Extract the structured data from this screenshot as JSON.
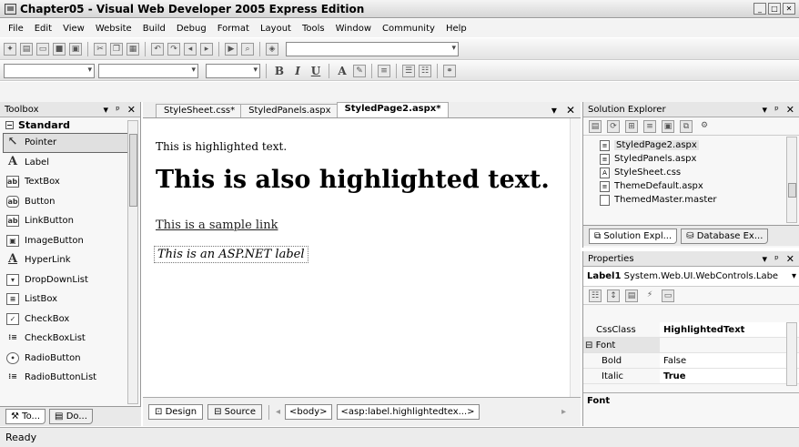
{
  "window": {
    "title": "Chapter05 - Visual Web Developer 2005 Express Edition"
  },
  "menu": [
    "File",
    "Edit",
    "View",
    "Website",
    "Build",
    "Debug",
    "Format",
    "Layout",
    "Tools",
    "Window",
    "Community",
    "Help"
  ],
  "toolbox": {
    "title": "Toolbox",
    "section": "Standard",
    "items": [
      {
        "label": "Pointer",
        "icon": "pointer-icon",
        "selected": true
      },
      {
        "label": "Label",
        "icon": "label-icon"
      },
      {
        "label": "TextBox",
        "icon": "textbox-icon"
      },
      {
        "label": "Button",
        "icon": "button-icon"
      },
      {
        "label": "LinkButton",
        "icon": "linkbutton-icon"
      },
      {
        "label": "ImageButton",
        "icon": "imagebutton-icon"
      },
      {
        "label": "HyperLink",
        "icon": "hyperlink-icon"
      },
      {
        "label": "DropDownList",
        "icon": "dropdownlist-icon"
      },
      {
        "label": "ListBox",
        "icon": "listbox-icon"
      },
      {
        "label": "CheckBox",
        "icon": "checkbox-icon"
      },
      {
        "label": "CheckBoxList",
        "icon": "checkboxlist-icon"
      },
      {
        "label": "RadioButton",
        "icon": "radiobutton-icon"
      },
      {
        "label": "RadioButtonList",
        "icon": "radiobuttonlist-icon"
      }
    ],
    "bottom_tabs": [
      "To...",
      "Do..."
    ]
  },
  "editor": {
    "tabs": [
      {
        "label": "StyleSheet.css*",
        "active": false
      },
      {
        "label": "StyledPanels.aspx",
        "active": false
      },
      {
        "label": "StyledPage2.aspx*",
        "active": true
      }
    ],
    "content": {
      "line1": "This is highlighted text.",
      "heading": "This is also highlighted text.",
      "link": "This is a sample link",
      "label": "This is an ASP.NET label"
    },
    "views": [
      "Design",
      "Source"
    ],
    "breadcrumbs": [
      "<body>",
      "<asp:label.highlightedtex...>"
    ]
  },
  "solution_explorer": {
    "title": "Solution Explorer",
    "files": [
      "StyledPage2.aspx",
      "StyledPanels.aspx",
      "StyleSheet.css",
      "ThemeDefault.aspx",
      "ThemedMaster.master"
    ],
    "tabs": [
      "Solution Expl...",
      "Database Ex..."
    ]
  },
  "properties": {
    "title": "Properties",
    "object": "Label1",
    "type": "System.Web.UI.WebControls.Labe",
    "rows": [
      {
        "name": "CssClass",
        "value": "HighlightedText",
        "bold": true
      },
      {
        "name": "Font",
        "value": "",
        "category": true
      },
      {
        "name": "Bold",
        "value": "False"
      },
      {
        "name": "Italic",
        "value": "True",
        "bold": true
      }
    ],
    "description_title": "Font"
  },
  "status": "Ready"
}
